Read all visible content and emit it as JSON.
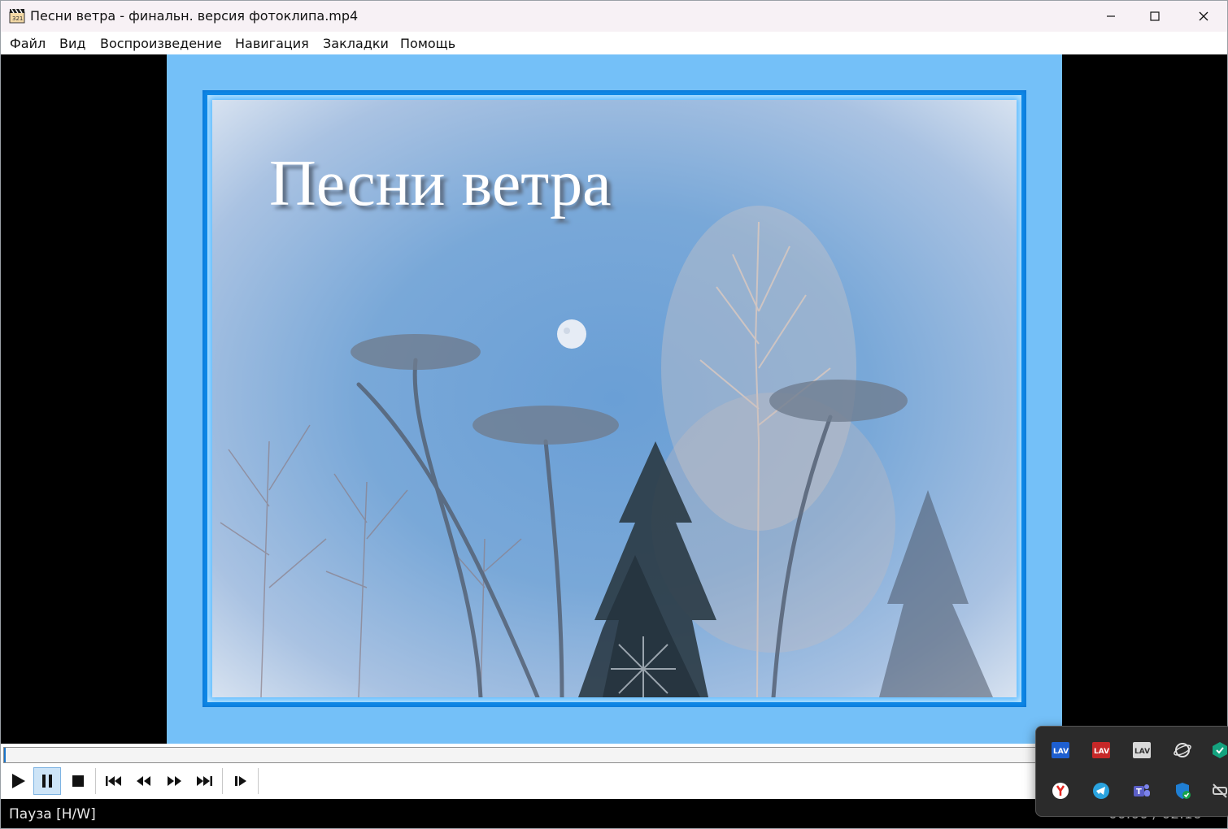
{
  "window": {
    "title": "Песни ветра - финальн. версия фотоклипа.mp4",
    "app_icon": "clapperboard-icon"
  },
  "menu": {
    "items": [
      "Файл",
      "Вид",
      "Воспроизведение",
      "Навигация",
      "Закладки",
      "Помощь"
    ]
  },
  "video": {
    "title_overlay": "Песни ветра"
  },
  "seek": {
    "progress": 0.0
  },
  "controls": {
    "buttons": [
      "play-icon",
      "pause-icon",
      "stop-icon",
      "skip-back-icon",
      "rewind-icon",
      "fast-forward-icon",
      "skip-forward-icon",
      "frame-step-icon"
    ],
    "active": "pause-icon"
  },
  "status": {
    "text": "Пауза [H/W]",
    "time": "00:00 / 02:16"
  },
  "tray": {
    "icons": [
      "lav-splitter-icon",
      "lav-audio-icon",
      "lav-video-icon",
      "network-globe-icon",
      "security-check-icon",
      "yandex-browser-icon",
      "telegram-icon",
      "teams-icon",
      "defender-shield-icon",
      "network-muted-icon"
    ]
  },
  "colors": {
    "frame_bg": "#74c0f8",
    "photo_border": "#0e88e6",
    "accent": "#1a73c7"
  }
}
